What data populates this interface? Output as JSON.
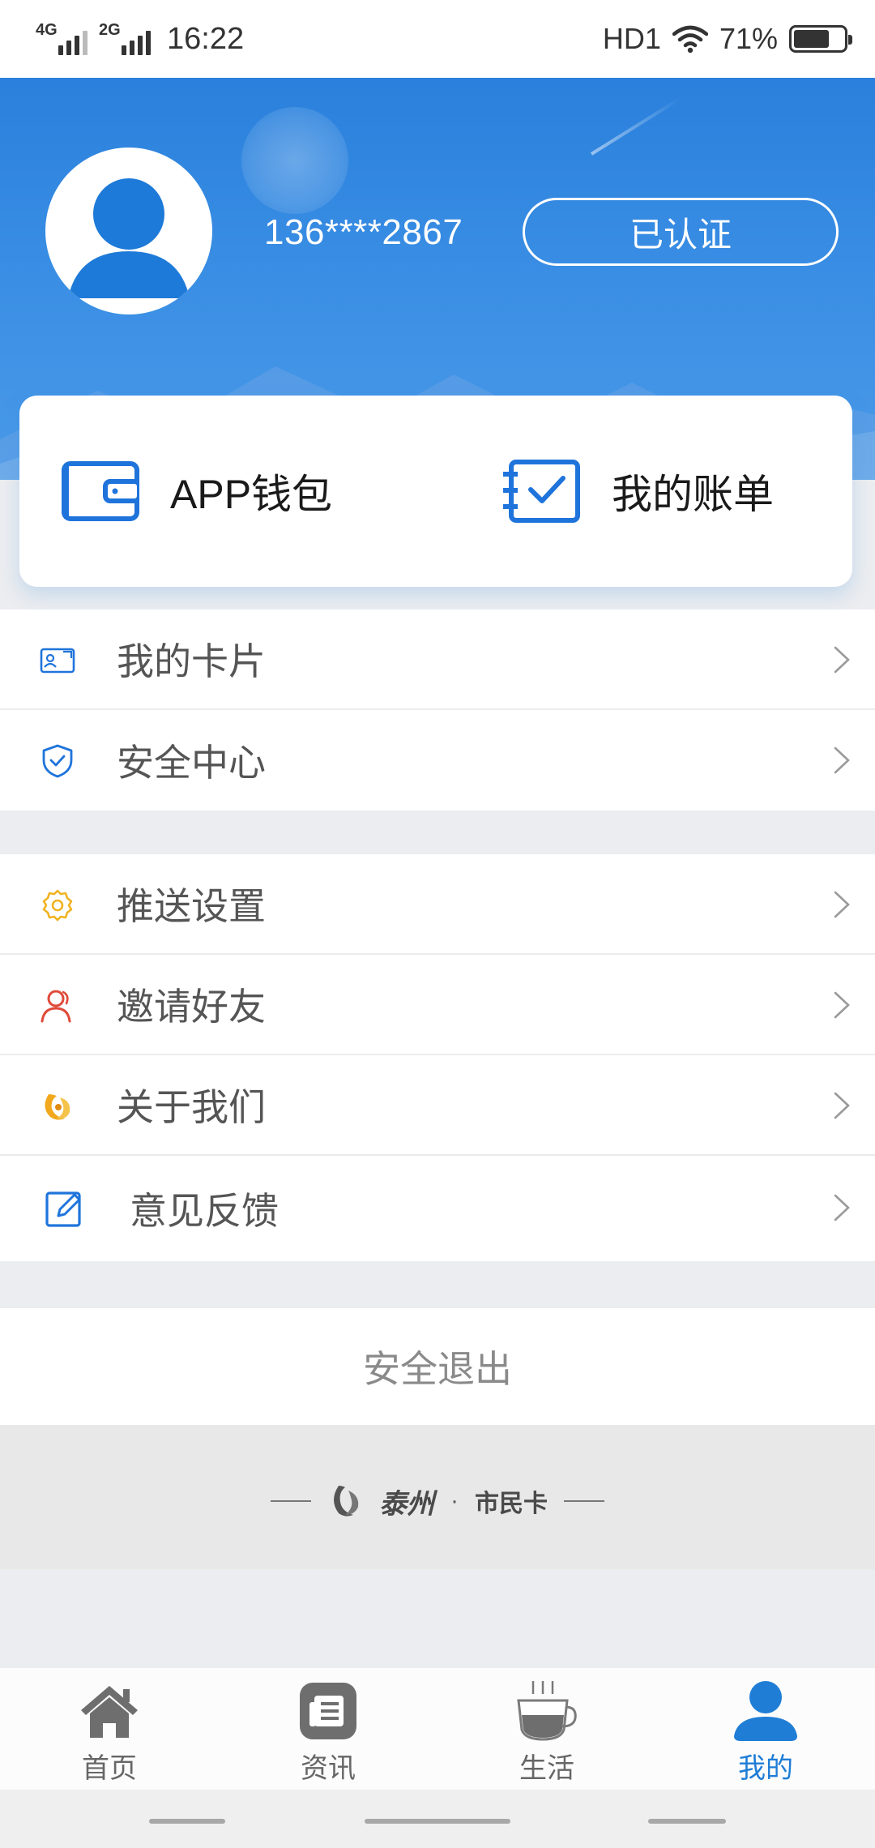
{
  "status_bar": {
    "net1": "4G",
    "net2": "2G",
    "time": "16:22",
    "hd": "HD1",
    "battery": "71%",
    "battery_level": 0.71
  },
  "header": {
    "phone": "136****2867",
    "verified_label": "已认证"
  },
  "wallet_card": {
    "wallet_label": "APP钱包",
    "bill_label": "我的账单",
    "accent_color": "#1f74db"
  },
  "menu_group1": [
    {
      "label": "我的卡片",
      "icon": "id-card-icon"
    },
    {
      "label": "安全中心",
      "icon": "shield-check-icon"
    }
  ],
  "menu_group2": [
    {
      "label": "推送设置",
      "icon": "gear-icon"
    },
    {
      "label": "邀请好友",
      "icon": "user-outline-icon"
    },
    {
      "label": "关于我们",
      "icon": "phoenix-logo-icon"
    },
    {
      "label": "意见反馈",
      "icon": "edit-icon"
    }
  ],
  "logout_label": "安全退出",
  "brand": {
    "name": "泰州",
    "dot": "·",
    "sub": "市民卡"
  },
  "tabs": [
    {
      "label": "首页",
      "icon": "home-icon",
      "active": false
    },
    {
      "label": "资讯",
      "icon": "news-icon",
      "active": false
    },
    {
      "label": "生活",
      "icon": "coffee-cup-icon",
      "active": false
    },
    {
      "label": "我的",
      "icon": "user-icon",
      "active": true
    }
  ],
  "colors": {
    "header_blue": "#2a80dc",
    "active_tab": "#1f7dd6",
    "inactive_tab": "#666666"
  }
}
